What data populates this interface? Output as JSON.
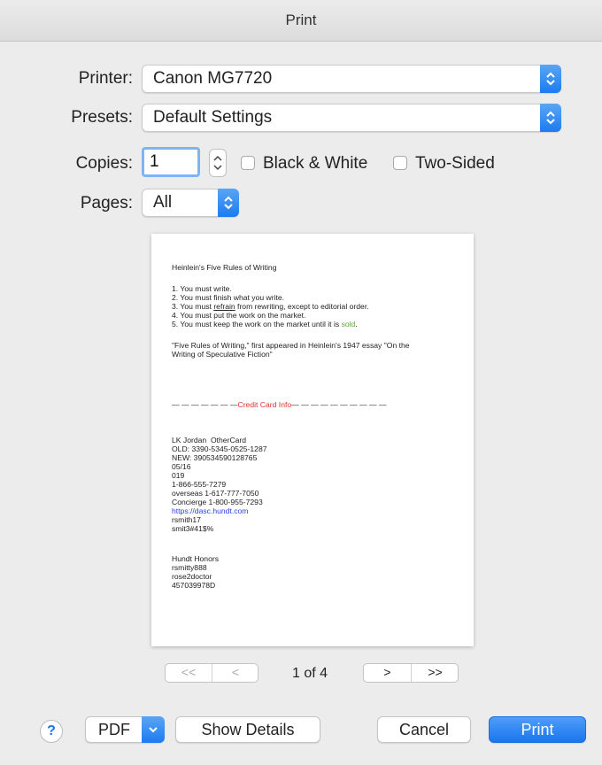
{
  "window": {
    "title": "Print"
  },
  "printer": {
    "label": "Printer:",
    "value": "Canon MG7720"
  },
  "presets": {
    "label": "Presets:",
    "value": "Default Settings"
  },
  "copies": {
    "label": "Copies:",
    "value": "1"
  },
  "options": {
    "black_white": "Black & White",
    "two_sided": "Two-Sided"
  },
  "pages": {
    "label": "Pages:",
    "value": "All"
  },
  "document": {
    "title": "Heinlein's Five Rules of Writing",
    "rules": [
      "1. You must write.",
      "2. You must finish what you write.",
      "3. You must refrain from rewriting, except to editorial order.",
      "4. You must put the work on the market.",
      "5. You must keep the work on the market until it is sold."
    ],
    "quote_line1": "\"Five Rules of Writing,\" first appeared in Heinlein's 1947 essay \"On the",
    "quote_line2": "Writing of Speculative Fiction\"",
    "divider_left": "— — — — — — —",
    "divider_label": "Credit Card Info",
    "divider_right": "— — — — — — — — — —",
    "card_lines": [
      "LK Jordan  OtherCard",
      "OLD: 3390-5345-0525-1287",
      "NEW: 390534590128765",
      "05/16",
      "019",
      "1-866-555-7279",
      "overseas 1-617-777-7050",
      "Concierge 1-800-955-7293"
    ],
    "link": "https://dasc.hundt.com",
    "login_lines": [
      "rsmith17",
      "smit3#41$%"
    ],
    "honors_lines": [
      "Hundt Honors",
      "rsmitty888",
      "rose2doctor",
      "457039978D"
    ]
  },
  "pagination": {
    "first": "<<",
    "prev": "<",
    "indicator": "1 of 4",
    "next": ">",
    "last": ">>"
  },
  "buttons": {
    "help": "?",
    "pdf": "PDF",
    "show_details": "Show Details",
    "cancel": "Cancel",
    "print": "Print"
  },
  "colors": {
    "accent": "#1a76ef",
    "divider_red": "#e0312a",
    "sold_green": "#5aa83c",
    "link_blue": "#2b3fdc"
  }
}
